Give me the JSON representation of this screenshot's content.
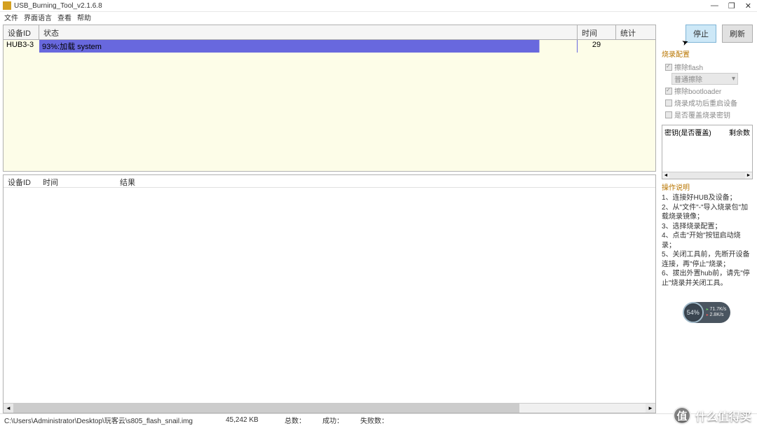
{
  "titlebar": {
    "title": "USB_Burning_Tool_v2.1.6.8"
  },
  "menu": {
    "file": "文件",
    "lang": "界面语言",
    "view": "查看",
    "help": "帮助"
  },
  "deviceTable": {
    "headers": {
      "id": "设备ID",
      "status": "状态",
      "time": "时间",
      "stat": "统计"
    },
    "row": {
      "id": "HUB3-3",
      "status": "93%:加载 system",
      "time": "29",
      "stat": ""
    }
  },
  "logTable": {
    "headers": {
      "id": "设备ID",
      "time": "时间",
      "result": "结果"
    }
  },
  "actions": {
    "stop": "停止",
    "refresh": "刷新"
  },
  "config": {
    "title": "烧录配置",
    "eraseFlash": "擦除flash",
    "eraseMode": "普通擦除",
    "eraseBoot": "擦除bootloader",
    "rebootAfter": "烧录成功后重启设备",
    "overwriteKey": "是否覆盖烧录密钥"
  },
  "keyPanel": {
    "col1": "密钥(是否覆盖)",
    "col2": "剩余数"
  },
  "instructions": {
    "title": "操作说明",
    "l1": "1、连接好HUB及设备；",
    "l2": "2、从\"文件\"-\"导入烧录包\"加载烧录镜像；",
    "l3": "3、选择烧录配置；",
    "l4": "4、点击\"开始\"按钮启动烧录；",
    "l5": "5、关闭工具前，先断开设备连接，再\"停止\"烧录；",
    "l6": "6、拔出外置hub前，请先\"停止\"烧录并关闭工具。"
  },
  "perf": {
    "pct": "54%",
    "up": "71.7K/s",
    "down": "2.8K/s"
  },
  "statusbar": {
    "path": "C:\\Users\\Administrator\\Desktop\\玩客云\\s805_flash_snail.img",
    "size": "45,242 KB",
    "total": "总数：",
    "success": "成功：",
    "fail": "失败数："
  },
  "watermark": {
    "char": "值",
    "text": "什么值得买"
  }
}
